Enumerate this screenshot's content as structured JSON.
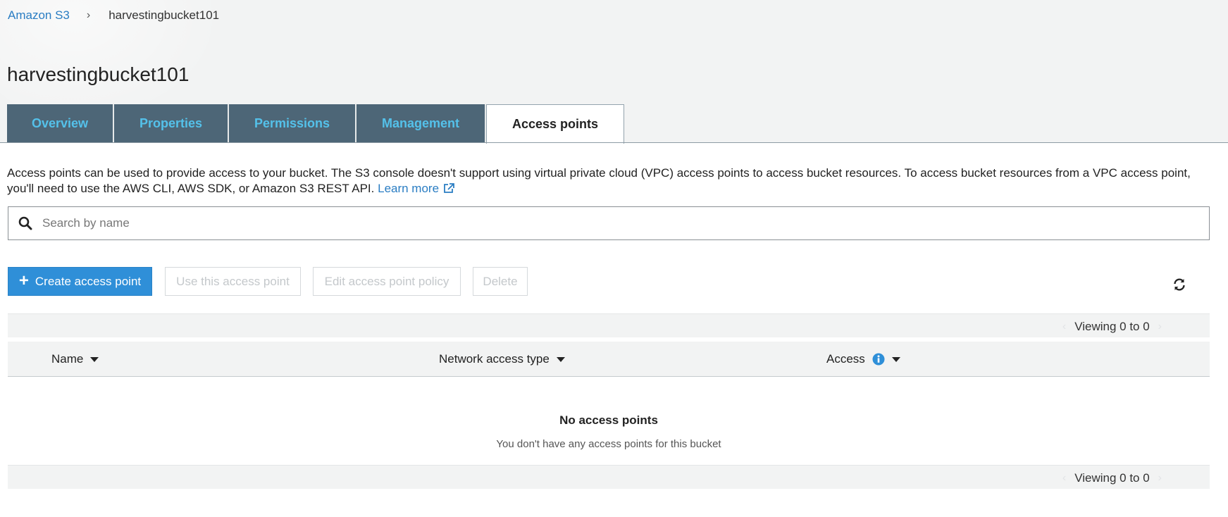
{
  "breadcrumb": {
    "root": "Amazon S3",
    "separator": "›",
    "current": "harvestingbucket101"
  },
  "page": {
    "title": "harvestingbucket101"
  },
  "tabs": [
    {
      "label": "Overview",
      "active": false
    },
    {
      "label": "Properties",
      "active": false
    },
    {
      "label": "Permissions",
      "active": false
    },
    {
      "label": "Management",
      "active": false
    },
    {
      "label": "Access points",
      "active": true
    }
  ],
  "description": {
    "text": "Access points can be used to provide access to your bucket. The S3 console doesn't support using virtual private cloud (VPC) access points to access bucket resources. To access bucket resources from a VPC access point, you'll need to use the AWS CLI, AWS SDK, or Amazon S3 REST API.",
    "link_label": "Learn more",
    "link_icon": "external-link-icon"
  },
  "search": {
    "placeholder": "Search by name",
    "value": "",
    "icon": "search-icon"
  },
  "toolbar": {
    "create_label": "Create access point",
    "use_label": "Use this access point",
    "edit_label": "Edit access point policy",
    "delete_label": "Delete",
    "refresh_icon": "refresh-icon"
  },
  "pager": {
    "top_text": "Viewing 0 to 0",
    "bottom_text": "Viewing 0 to 0",
    "prev": "‹",
    "next": "›"
  },
  "table": {
    "columns": [
      {
        "label": "Name"
      },
      {
        "label": "Network access type"
      },
      {
        "label": "Access",
        "info_icon": "info-icon"
      }
    ],
    "rows": []
  },
  "empty_state": {
    "title": "No access points",
    "subtitle": "You don't have any access points for this bucket"
  },
  "colors": {
    "accent": "#2f8fd8",
    "link": "#2a7dc3",
    "tab_bg": "#4d6677",
    "tab_text": "#54c1ea"
  }
}
